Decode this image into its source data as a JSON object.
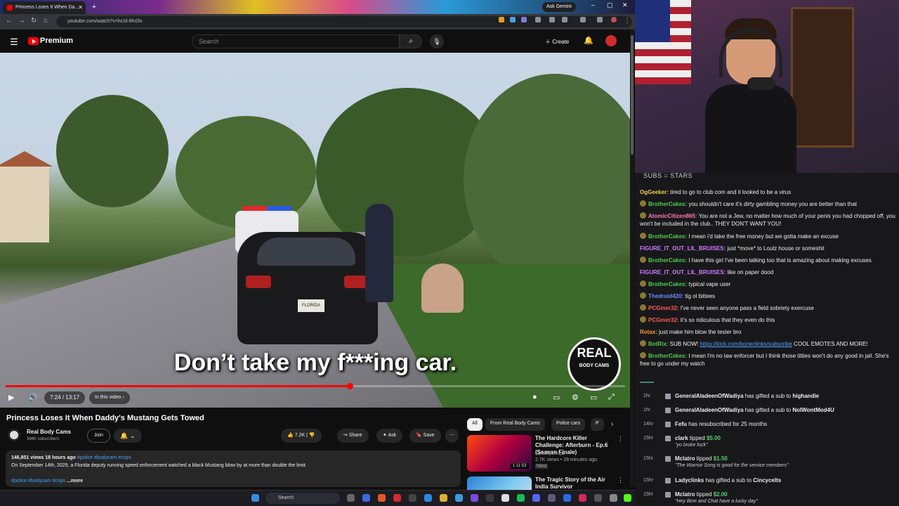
{
  "browser": {
    "tab_title": "Princess Loses It When Da...",
    "gemini_label": "Ask Gemini",
    "url": "youtube.com/watch?v=hc!d-6fn2lo"
  },
  "yt": {
    "brand": "Premium",
    "search_placeholder": "Search",
    "create_label": "Create"
  },
  "video": {
    "caption": "Don’t take my f***ing car.",
    "badge_title": "REAL",
    "badge_sub": "BODY CAMS",
    "plate": "FLORIDA",
    "time": "7:24 / 13:17",
    "in_this_video": "In this video",
    "progress": 0.555
  },
  "info": {
    "title": "Princess Loses It When Daddy's Mustang Gets Towed",
    "channel": "Real Body Cams",
    "subscribers": "366K subscribers",
    "join": "Join",
    "likes": "7.2K",
    "share": "Share",
    "ask": "Ask",
    "save": "Save",
    "stats": "146,851 views  18 hours ago",
    "hashtags_top": "#police #bodycam #cops",
    "description": "On September 14th, 2025, a Florida deputy running speed enforcement watched a black Mustang blow by at more than double the limit.",
    "hashtags_bottom": "#police #bodycam #cops",
    "more": "...more"
  },
  "chips": [
    "All",
    "From Real Body Cams",
    "Police cars",
    "P"
  ],
  "recs": [
    {
      "title": "The Hardcore Killer Challenge: Afterburn - Ep.6 (Season Finale)",
      "channel": "SpookyLoopz",
      "meta": "2.7K views • 28 minutes ago",
      "badge": "New",
      "duration": "1:11:53"
    },
    {
      "title": "The Tragic Story of the Air India Survivor",
      "channel": "",
      "meta": "",
      "badge": "",
      "duration": ""
    }
  ],
  "taskbar": {
    "search": "Search"
  },
  "stream": {
    "subs_line": "SUBS = STARS",
    "chat": [
      {
        "user": "OgGeeker",
        "color": "#e8d44d",
        "badge": false,
        "text": "tired to go to club com and it looked to be a virus"
      },
      {
        "user": "BrotherCakes",
        "color": "#4ecb4e",
        "badge": true,
        "text": "you shouldn't care it's dirty gambling money you are better than that"
      },
      {
        "user": "AtomicCitizen865",
        "color": "#ff7ab8",
        "badge": true,
        "text": "You are not a Jew, no matter how much of your penis you had chopped off, you won't be included in the club.. THEY DON'T WANT YOU!"
      },
      {
        "user": "BrotherCakes",
        "color": "#4ecb4e",
        "badge": true,
        "text": "I mean i'd take the free money but we gotta make an excuse"
      },
      {
        "user": "FIGURE_IT_OUT_LIL_BRUISES",
        "color": "#d07bff",
        "badge": false,
        "text": "just *move* to Loulz house or someshit"
      },
      {
        "user": "BrotherCakes",
        "color": "#4ecb4e",
        "badge": true,
        "text": "I have this girl I've been talking too that is amazing about making excuses"
      },
      {
        "user": "FIGURE_IT_OUT_LIL_BRUISES",
        "color": "#d07bff",
        "badge": false,
        "text": "like on paper dood"
      },
      {
        "user": "BrotherCakes",
        "color": "#4ecb4e",
        "badge": true,
        "text": "typical vape user"
      },
      {
        "user": "Thedroid420",
        "color": "#6b8cff",
        "badge": true,
        "text": "tig ol bittees"
      },
      {
        "user": "PCGmer32",
        "color": "#ff5a5a",
        "badge": true,
        "text": "I've never seen anyone pass a field sobriety exercuse"
      },
      {
        "user": "PCGmer32",
        "color": "#ff5a5a",
        "badge": true,
        "text": "it's so ridiculous that they even do this"
      },
      {
        "user": "Rotax",
        "color": "#ff9a3c",
        "badge": false,
        "text": "just make him blow the tester bro"
      },
      {
        "user": "BotRix",
        "color": "#4ecb4e",
        "badge": true,
        "text": "SUB NOW!",
        "link": "https://kick.com/boneclinks/subscribe",
        "after": " COOL EMOTES AND MORE!"
      },
      {
        "user": "BrotherCakes",
        "color": "#4ecb4e",
        "badge": true,
        "text": "I mean I'm no law enforcer but I think those titties won't do any good in jail. She's free to go under my watch"
      }
    ],
    "events": [
      {
        "time": "1hr",
        "user": "GeneralAladeenOfWadiya",
        "text": " has gifted a sub to ",
        "target": "highandie",
        "quote": ""
      },
      {
        "time": "1hr",
        "user": "GeneralAladeenOfWadiya",
        "text": " has gifted a sub to ",
        "target": "NoIWontMod4U",
        "quote": ""
      },
      {
        "time": "14hr",
        "user": "Fefu",
        "text": " has resubscribed for 25 months",
        "target": "",
        "quote": ""
      },
      {
        "time": "15hr",
        "user": "clark",
        "text": " tipped ",
        "target": "$5.00",
        "quote": "\"yo broke fuck\""
      },
      {
        "time": "15hr",
        "user": "Mclatro",
        "text": " tipped ",
        "target": "$1.50",
        "quote": "\"The Warrior Song is good for the service members\""
      },
      {
        "time": "15hr",
        "user": "Ladyclinks",
        "text": " has gifted a sub to ",
        "target": "Cincycelts",
        "quote": ""
      },
      {
        "time": "15hr",
        "user": "Mclatro",
        "text": " tipped ",
        "target": "$2.00",
        "quote": "\"Hey Bine and Chat have a lucky day\""
      }
    ]
  }
}
